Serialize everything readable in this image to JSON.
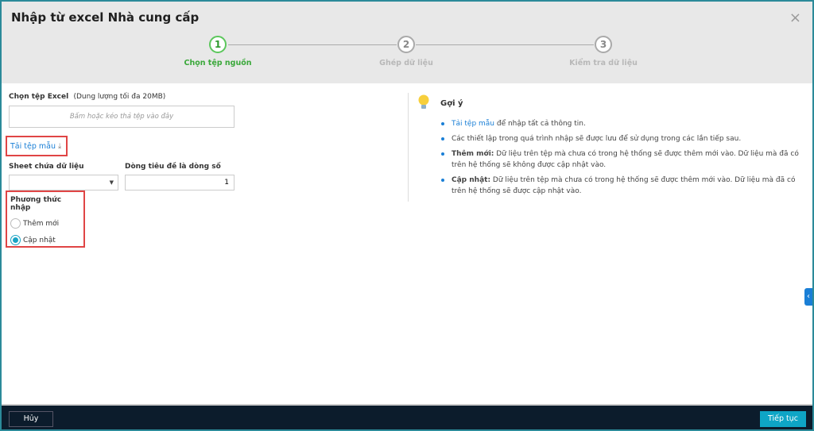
{
  "dialog": {
    "title": "Nhập từ excel Nhà cung cấp",
    "close_icon": "×"
  },
  "steps": [
    {
      "num": "1",
      "label": "Chọn tệp nguồn",
      "active": true
    },
    {
      "num": "2",
      "label": "Ghép dữ liệu"
    },
    {
      "num": "3",
      "label": "Kiểm tra dữ liệu"
    }
  ],
  "file": {
    "label": "Chọn tệp Excel",
    "note": "(Dung lượng tối đa 20MB)",
    "placeholder": "Bấm hoặc kéo thả tệp vào đây",
    "template_link": "Tải tệp mẫu"
  },
  "sheet": {
    "label": "Sheet chứa dữ liệu",
    "value": ""
  },
  "header_row": {
    "label": "Dòng tiêu đề là dòng số",
    "value": "1"
  },
  "method": {
    "label": "Phương thức nhập",
    "options": [
      "Thêm mới",
      "Cập nhật"
    ],
    "selected": "Cập nhật"
  },
  "hint": {
    "title": "Gợi ý",
    "items": [
      {
        "link": "Tải tệp mẫu",
        "text": " để nhập tất cả thông tin."
      },
      {
        "text": "Các thiết lập trong quá trình nhập sẽ được lưu để sử dụng trong các lần tiếp sau."
      },
      {
        "bold": "Thêm mới:",
        "text": " Dữ liệu trên tệp mà chưa có trong hệ thống sẽ được thêm mới vào. Dữ liệu mà đã có trên hệ thống sẽ không được cập nhật vào."
      },
      {
        "bold": "Cập nhật:",
        "text": " Dữ liệu trên tệp mà chưa có trong hệ thống sẽ được thêm mới vào. Dữ liệu mà đã có trên hệ thống sẽ được cập nhật vào."
      }
    ]
  },
  "footer": {
    "cancel": "Hủy",
    "next": "Tiếp tục"
  },
  "colors": {
    "accent": "#0ea5c6",
    "active_step": "#3aa83a",
    "link": "#1a7fd6",
    "footer": "#0c1c2c"
  }
}
